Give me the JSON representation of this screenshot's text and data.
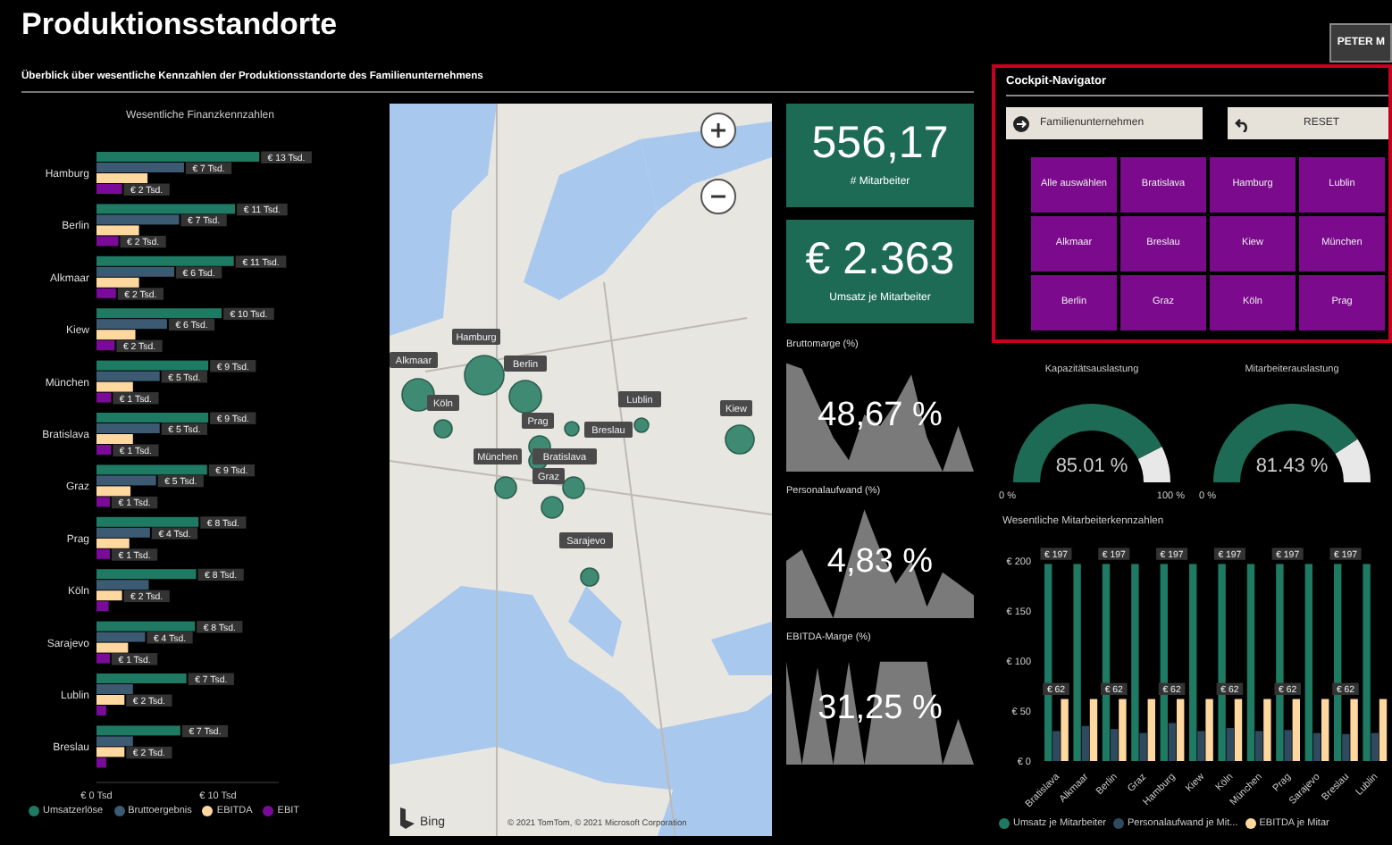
{
  "header": {
    "title": "Produktionsstandorte",
    "subtitle": "Überblick über wesentliche Kennzahlen der Produktionsstandorte des Familienunternehmens",
    "user_badge": "PETER M"
  },
  "finance_chart": {
    "chart_data": {
      "type": "bar",
      "orientation": "horizontal",
      "title": "Wesentliche Finanzkennzahlen",
      "categories": [
        "Hamburg",
        "Berlin",
        "Alkmaar",
        "Kiew",
        "München",
        "Bratislava",
        "Graz",
        "Prag",
        "Köln",
        "Sarajevo",
        "Lublin",
        "Breslau"
      ],
      "xlim": [
        0,
        15
      ],
      "xticks": [
        {
          "value": 0,
          "label": "€ 0 Tsd"
        },
        {
          "value": 10,
          "label": "€ 10 Tsd"
        }
      ],
      "series": [
        {
          "name": "Umsatzerlöse",
          "color": "#1f7a63",
          "values": [
            13.4,
            11.4,
            11.3,
            10.3,
            9.2,
            9.2,
            9.1,
            8.4,
            8.2,
            8.1,
            7.4,
            6.9
          ],
          "value_labels": [
            "€ 13 Tsd.",
            "€ 11 Tsd.",
            "€ 11 Tsd.",
            "€ 10 Tsd.",
            "€ 9 Tsd.",
            "€ 9 Tsd.",
            "€ 9 Tsd.",
            "€ 8 Tsd.",
            "€ 8 Tsd.",
            "€ 8 Tsd.",
            "€ 7 Tsd.",
            "€ 7 Tsd."
          ]
        },
        {
          "name": "Bruttoergebnis",
          "color": "#3d5a73",
          "values": [
            7.2,
            6.8,
            6.4,
            5.8,
            5.2,
            5.2,
            4.9,
            4.4,
            4.3,
            4.0,
            3.0,
            3.0
          ],
          "value_labels": [
            "€ 7 Tsd.",
            "€ 7 Tsd.",
            "€ 6 Tsd.",
            "€ 6 Tsd.",
            "€ 5 Tsd.",
            "€ 5 Tsd.",
            "€ 5 Tsd.",
            "€ 4 Tsd.",
            null,
            "€ 4 Tsd.",
            null,
            null
          ]
        },
        {
          "name": "EBITDA",
          "color": "#ffd8a0",
          "values": [
            4.2,
            3.5,
            3.5,
            3.2,
            3.0,
            3.0,
            2.8,
            2.7,
            2.1,
            2.6,
            2.3,
            2.3
          ],
          "value_labels": [
            null,
            null,
            null,
            null,
            null,
            null,
            null,
            null,
            "€ 2 Tsd.",
            null,
            "€ 2 Tsd.",
            "€ 2 Tsd."
          ]
        },
        {
          "name": "EBIT",
          "color": "#7a0a9a",
          "values": [
            2.1,
            1.8,
            1.6,
            1.5,
            1.2,
            1.2,
            1.1,
            1.1,
            1.0,
            1.1,
            0.8,
            0.8
          ],
          "value_labels": [
            "€ 2 Tsd.",
            "€ 2 Tsd.",
            "€ 2 Tsd.",
            "€ 2 Tsd.",
            "€ 1 Tsd.",
            "€ 1 Tsd.",
            "€ 1 Tsd.",
            "€ 1 Tsd.",
            null,
            "€ 1 Tsd.",
            null,
            null
          ]
        }
      ]
    }
  },
  "map": {
    "locations": [
      "Hamburg",
      "Alkmaar",
      "Berlin",
      "Köln",
      "Prag",
      "Breslau",
      "Lublin",
      "Kiew",
      "München",
      "Bratislava",
      "Graz",
      "Sarajevo"
    ],
    "logo_text": "Bing",
    "copyright": "© 2021 TomTom, © 2021 Microsoft Corporation"
  },
  "kpis": [
    {
      "value": "556,17",
      "label": "# Mitarbeiter"
    },
    {
      "value": "€ 2.363",
      "label": "Umsatz je Mitarbeiter"
    }
  ],
  "margins": [
    {
      "title": "Bruttomarge (%)",
      "value": "48,67 %"
    },
    {
      "title": "Personalaufwand (%)",
      "value": "4,83 %"
    },
    {
      "title": "EBITDA-Marge (%)",
      "value": "31,25 %"
    }
  ],
  "navigator": {
    "title": "Cockpit-Navigator",
    "hierarchy_button": "Familienunternehmen",
    "reset_button": "RESET",
    "tiles": [
      "Alle auswählen",
      "Bratislava",
      "Hamburg",
      "Lublin",
      "Alkmaar",
      "Breslau",
      "Kiew",
      "München",
      "Berlin",
      "Graz",
      "Köln",
      "Prag"
    ]
  },
  "gauges": [
    {
      "title": "Kapazitätsauslastung",
      "level": 0.8501,
      "value": "85.01 %",
      "min_label": "0 %",
      "max_label": "100 %"
    },
    {
      "title": "Mitarbeiterauslastung",
      "level": 0.8143,
      "value": "81.43 %",
      "min_label": "0 %"
    }
  ],
  "employee_chart": {
    "chart_data": {
      "type": "bar",
      "title": "Wesentliche Mitarbeiterkennzahlen",
      "categories": [
        "Bratislava",
        "Alkmaar",
        "Berlin",
        "Graz",
        "Hamburg",
        "Kiew",
        "Köln",
        "München",
        "Prag",
        "Sarajevo",
        "Breslau",
        "Lublin"
      ],
      "ylim": [
        0,
        200
      ],
      "yticks": [
        {
          "value": 0,
          "label": "€ 0"
        },
        {
          "value": 50,
          "label": "€ 50"
        },
        {
          "value": 100,
          "label": "€ 100"
        },
        {
          "value": 150,
          "label": "€ 150"
        },
        {
          "value": 200,
          "label": "€ 200"
        }
      ],
      "series": [
        {
          "name": "Umsatz je Mitarbeiter",
          "color": "#1f7a63",
          "values": [
            197,
            197,
            197,
            197,
            197,
            197,
            197,
            197,
            197,
            197,
            197,
            197
          ],
          "value_labels": [
            "€ 197",
            null,
            "€ 197",
            null,
            "€ 197",
            null,
            "€ 197",
            null,
            "€ 197",
            null,
            "€ 197",
            null
          ]
        },
        {
          "name": "Personalaufwand je Mit...",
          "color": "#2f4a5e",
          "values": [
            30,
            35,
            32,
            28,
            38,
            30,
            33,
            30,
            31,
            28,
            27,
            28
          ]
        },
        {
          "name": "EBITDA je Mitar",
          "color": "#ffd8a0",
          "values": [
            62,
            62,
            62,
            62,
            62,
            62,
            62,
            62,
            62,
            62,
            62,
            62
          ],
          "value_labels": [
            "€ 62",
            null,
            "€ 62",
            null,
            "€ 62",
            null,
            "€ 62",
            null,
            "€ 62",
            null,
            "€ 62",
            null
          ]
        }
      ]
    }
  }
}
